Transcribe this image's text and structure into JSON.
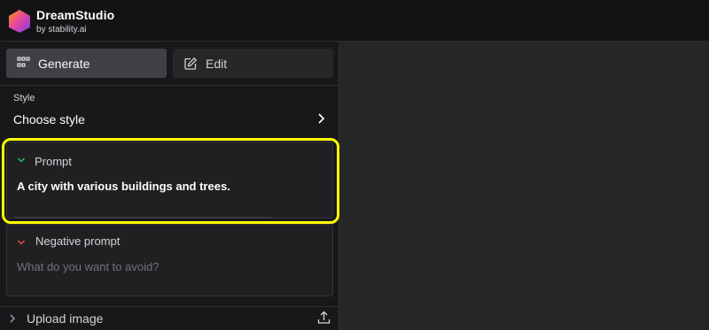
{
  "app": {
    "title": "DreamStudio",
    "subtitle": "by stability.ai",
    "logo_icon": "hexagon-gradient-logo"
  },
  "tabs": [
    {
      "label": "Generate",
      "icon": "grid-icon",
      "active": true
    },
    {
      "label": "Edit",
      "icon": "edit-icon",
      "active": false
    }
  ],
  "style": {
    "label": "Style",
    "value": "Choose style",
    "icon": "chevron-right-icon"
  },
  "prompt": {
    "label": "Prompt",
    "value": "A city with various buildings and trees.",
    "icon": "chevron-down-icon",
    "accent_color": "#22c55e"
  },
  "negative_prompt": {
    "label": "Negative prompt",
    "placeholder": "What do you want to avoid?",
    "value": "",
    "icon": "chevron-down-icon",
    "accent_color": "#ef4444"
  },
  "upload": {
    "label": "Upload image",
    "icon": "upload-icon"
  },
  "colors": {
    "highlight": "#ffff00",
    "sidebar_bg": "#18181b",
    "canvas_bg": "#262626"
  }
}
